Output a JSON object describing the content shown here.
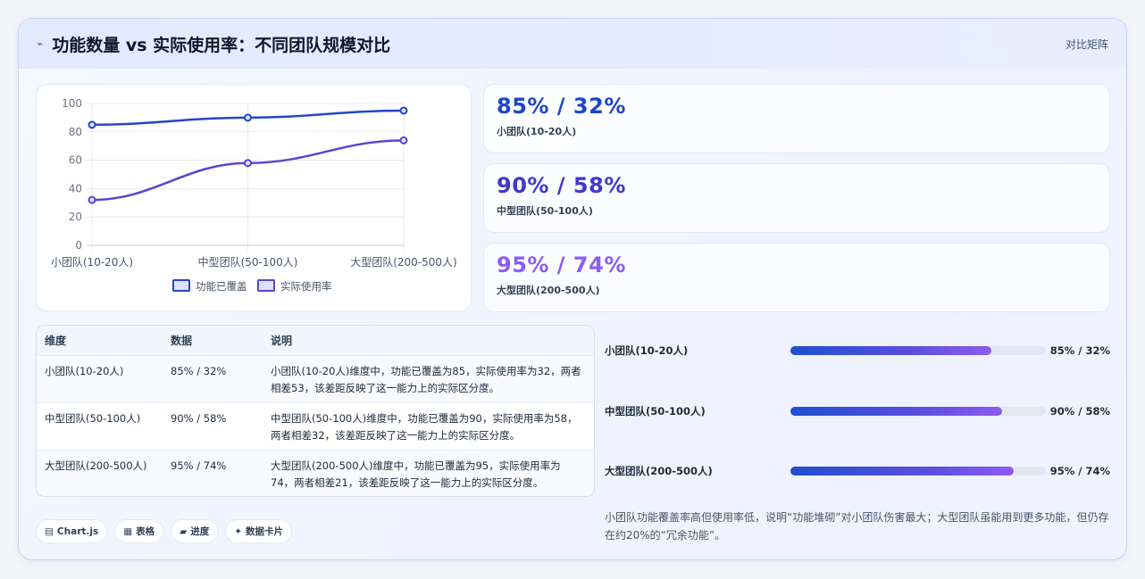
{
  "header": {
    "icon": "trend-icon",
    "title": "功能数量 vs 实际使用率：不同团队规模对比",
    "tag": "对比矩阵"
  },
  "chart_data": {
    "type": "line",
    "categories": [
      "小团队(10-20人)",
      "中型团队(50-100人)",
      "大型团队(200-500人)"
    ],
    "series": [
      {
        "name": "功能已覆盖",
        "values": [
          85,
          90,
          95
        ],
        "color": "#2347c5"
      },
      {
        "name": "实际使用率",
        "values": [
          32,
          58,
          74
        ],
        "color": "#5a44d0"
      }
    ],
    "ylim": [
      0,
      100
    ],
    "yticks": [
      0,
      20,
      40,
      60,
      80,
      100
    ],
    "grid": true,
    "legend": "bottom"
  },
  "stats": [
    {
      "value": "85% / 32%",
      "label": "小团队(10-20人)",
      "color": "#1f45c6"
    },
    {
      "value": "90% / 58%",
      "label": "中型团队(50-100人)",
      "color": "#4338ca"
    },
    {
      "value": "95% / 74%",
      "label": "大型团队(200-500人)",
      "color": "#8b5cf6"
    }
  ],
  "table": {
    "headers": [
      "维度",
      "数据",
      "说明"
    ],
    "rows": [
      {
        "dim": "小团队(10-20人)",
        "data": "85% / 32%",
        "desc": "小团队(10-20人)维度中，功能已覆盖为85，实际使用率为32，两者相差53，该差距反映了这一能力上的实际区分度。"
      },
      {
        "dim": "中型团队(50-100人)",
        "data": "90% / 58%",
        "desc": "中型团队(50-100人)维度中，功能已覆盖为90，实际使用率为58，两者相差32，该差距反映了这一能力上的实际区分度。"
      },
      {
        "dim": "大型团队(200-500人)",
        "data": "95% / 74%",
        "desc": "大型团队(200-500人)维度中，功能已覆盖为95，实际使用率为74，两者相差21，该差距反映了这一能力上的实际区分度。"
      }
    ]
  },
  "progress": [
    {
      "label": "小团队(10-20人)",
      "value": "85% / 32%",
      "fraction": 0.785
    },
    {
      "label": "中型团队(50-100人)",
      "value": "90% / 58%",
      "fraction": 0.83
    },
    {
      "label": "大型团队(200-500人)",
      "value": "95% / 74%",
      "fraction": 0.875
    }
  ],
  "pills": [
    {
      "icon": "chart-icon",
      "glyph": "▤",
      "label": "Chart.js"
    },
    {
      "icon": "table-icon",
      "glyph": "▦",
      "label": "表格"
    },
    {
      "icon": "progress-icon",
      "glyph": "▰",
      "label": "进度"
    },
    {
      "icon": "sparkle-icon",
      "glyph": "✦",
      "label": "数据卡片"
    }
  ],
  "note": "小团队功能覆盖率高但使用率低，说明“功能堆砌”对小团队伤害最大；大型团队虽能用到更多功能，但仍存在约20%的“冗余功能”。"
}
